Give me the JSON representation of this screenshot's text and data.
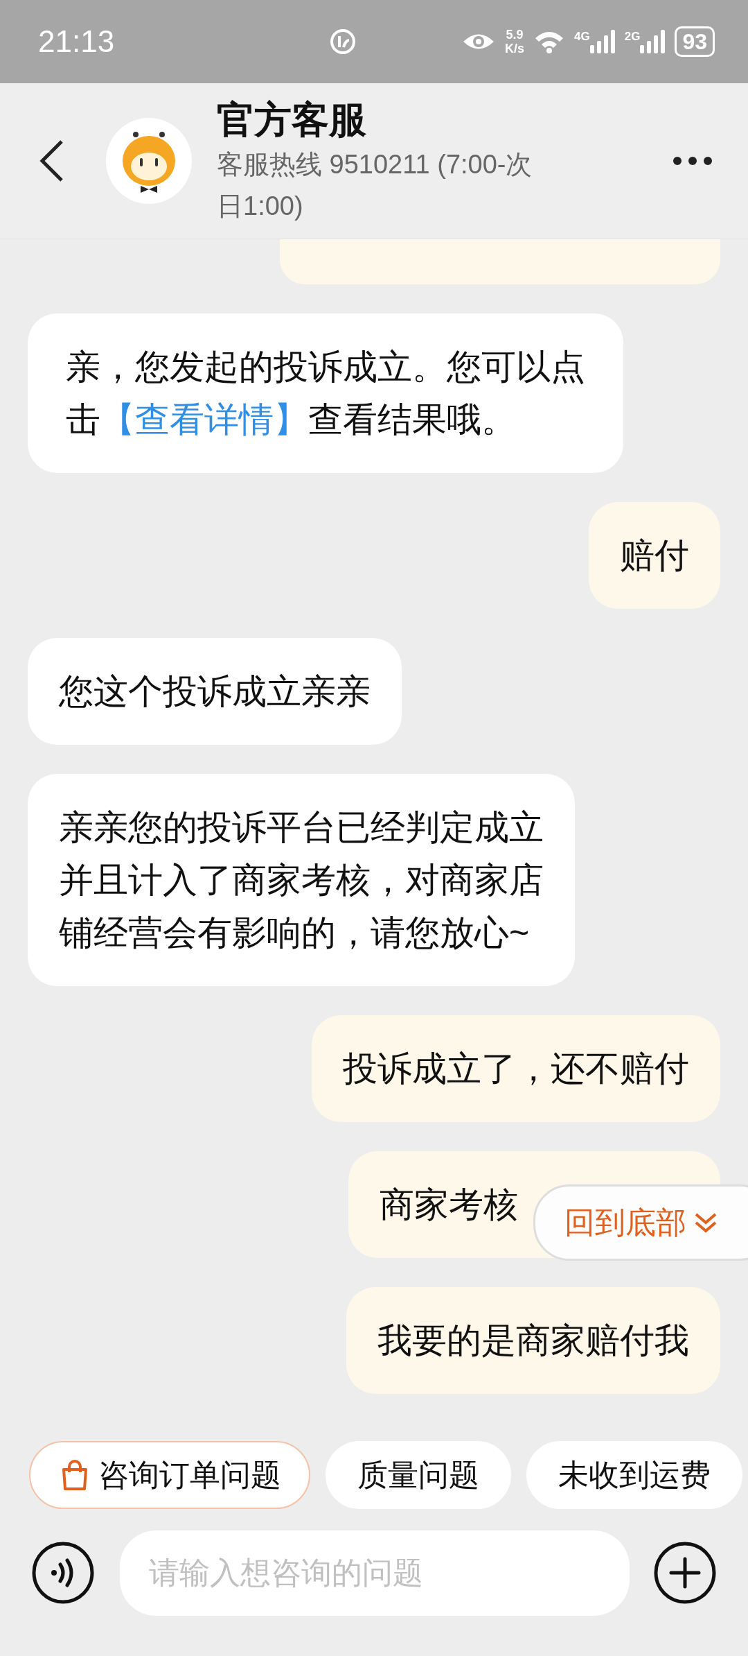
{
  "status_bar": {
    "time": "21:13",
    "net_speed": "5.9\nK/s",
    "network_1": "4G",
    "network_2": "2G",
    "battery": "93"
  },
  "header": {
    "title": "官方客服",
    "subtitle": "客服热线 9510211 (7:00-次日1:00)"
  },
  "messages": [
    {
      "kind": "incoming",
      "lines": [
        [
          {
            "kind": "text",
            "text": "亲，您发起的投诉成立。您可以点"
          }
        ],
        [
          {
            "kind": "text",
            "text": "击"
          },
          {
            "kind": "link",
            "text": "【查看详情】"
          },
          {
            "kind": "text",
            "text": "查看结果哦。"
          }
        ]
      ]
    },
    {
      "kind": "outgoing",
      "lines": [
        [
          {
            "kind": "text",
            "text": "赔付"
          }
        ]
      ]
    },
    {
      "kind": "incoming",
      "lines": [
        [
          {
            "kind": "text",
            "text": "您这个投诉成立亲亲"
          }
        ]
      ]
    },
    {
      "kind": "incoming",
      "lines": [
        [
          {
            "kind": "text",
            "text": "亲亲您的投诉平台已经判定成立"
          }
        ],
        [
          {
            "kind": "text",
            "text": "并且计入了商家考核，对商家店"
          }
        ],
        [
          {
            "kind": "text",
            "text": "铺经营会有影响的，请您放心~"
          }
        ]
      ]
    },
    {
      "kind": "outgoing",
      "lines": [
        [
          {
            "kind": "text",
            "text": "投诉成立了，还不赔付"
          }
        ]
      ]
    },
    {
      "kind": "covered",
      "lines": [
        [
          {
            "kind": "text",
            "text": "商家考核"
          }
        ]
      ]
    },
    {
      "kind": "outgoing",
      "lines": [
        [
          {
            "kind": "text",
            "text": "我要的是商家赔付我"
          }
        ]
      ]
    }
  ],
  "scroll_to_bottom": {
    "label": "回到底部"
  },
  "quick_replies": [
    {
      "label": "咨询订单问题",
      "selected": true
    },
    {
      "label": "质量问题",
      "selected": false
    },
    {
      "label": "未收到运费",
      "selected": false
    }
  ],
  "input": {
    "placeholder": "请输入想咨询的问题"
  }
}
